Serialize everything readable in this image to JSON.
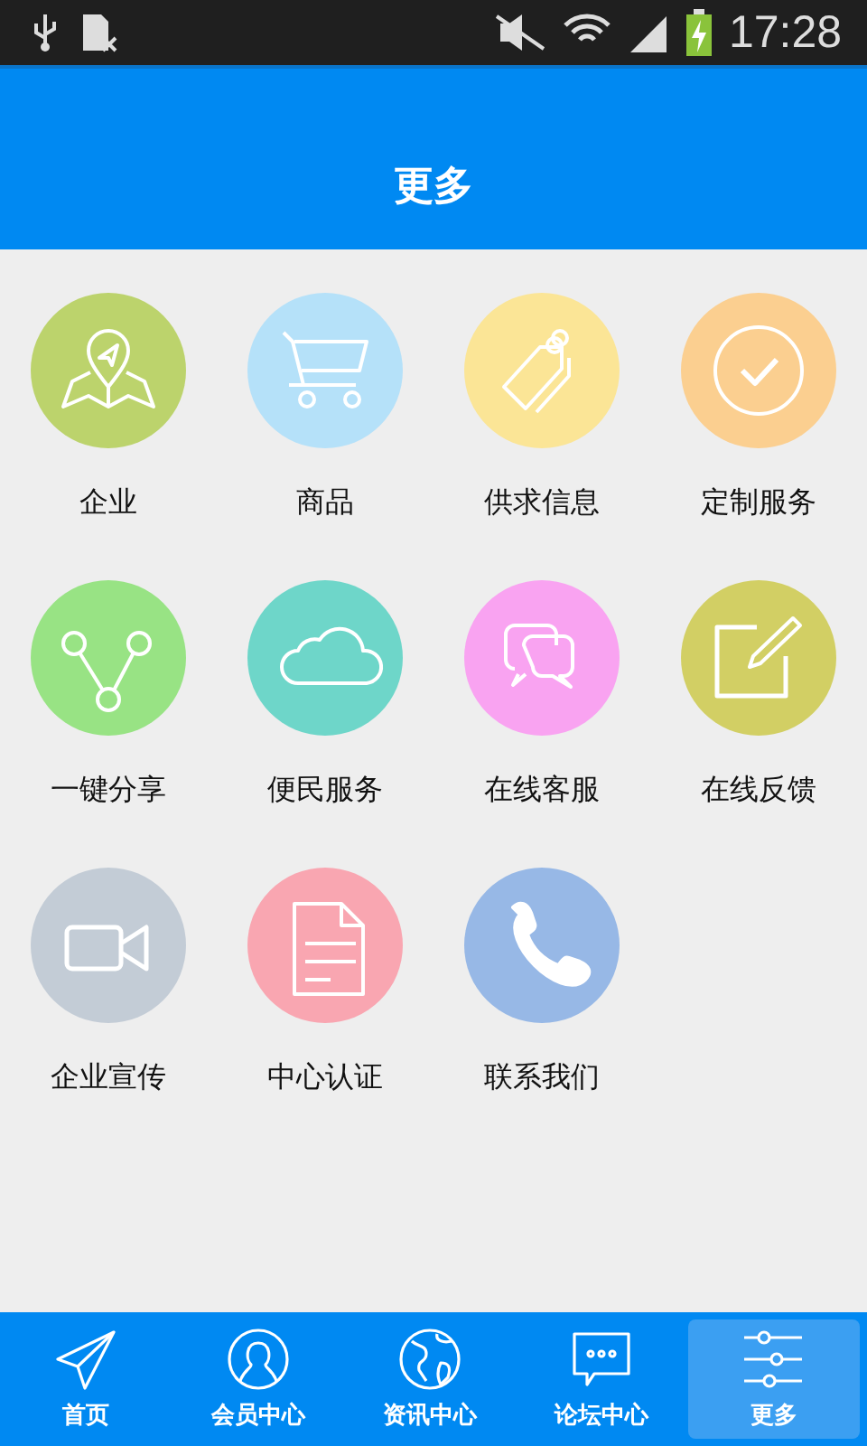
{
  "status_bar": {
    "time": "17:28"
  },
  "header": {
    "title": "更多"
  },
  "grid": [
    {
      "label": "企业",
      "kind": "map",
      "color": "#bcd36c"
    },
    {
      "label": "商品",
      "kind": "cart",
      "color": "#b5e1f9"
    },
    {
      "label": "供求信息",
      "kind": "tag",
      "color": "#fbe596"
    },
    {
      "label": "定制服务",
      "kind": "check",
      "color": "#fbcf90"
    },
    {
      "label": "一键分享",
      "kind": "share",
      "color": "#98e384"
    },
    {
      "label": "便民服务",
      "kind": "cloud",
      "color": "#6ed6c9"
    },
    {
      "label": "在线客服",
      "kind": "chat",
      "color": "#f9a3f1"
    },
    {
      "label": "在线反馈",
      "kind": "edit",
      "color": "#d2cf64"
    },
    {
      "label": "企业宣传",
      "kind": "video",
      "color": "#c3ccd6"
    },
    {
      "label": "中心认证",
      "kind": "doc",
      "color": "#f9a6b1"
    },
    {
      "label": "联系我们",
      "kind": "phone",
      "color": "#97b8e6"
    }
  ],
  "tabs": [
    {
      "label": "首页",
      "kind": "send",
      "selected": false
    },
    {
      "label": "会员中心",
      "kind": "user",
      "selected": false
    },
    {
      "label": "资讯中心",
      "kind": "globe",
      "selected": false
    },
    {
      "label": "论坛中心",
      "kind": "forum",
      "selected": false
    },
    {
      "label": "更多",
      "kind": "sliders",
      "selected": true
    }
  ]
}
